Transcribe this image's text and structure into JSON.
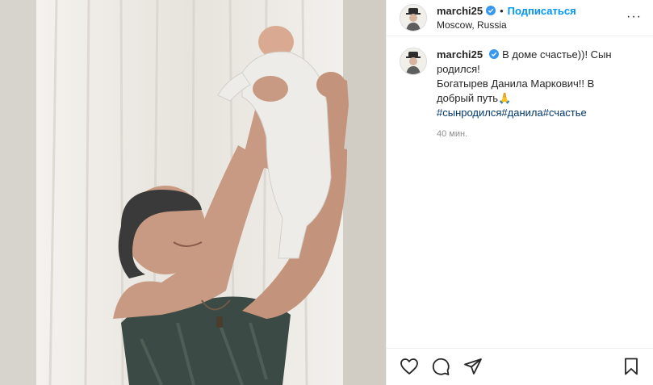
{
  "post": {
    "username": "marchi25",
    "dot": "•",
    "follow_label": "Подписаться",
    "location": "Moscow, Russia",
    "more_label": "···"
  },
  "caption": {
    "username": "marchi25",
    "line1": "В доме счастье))! Сын родился!",
    "line2": "Богатырев Данила Маркович!! В добрый путь🙏",
    "hashtags": [
      "#сынродился",
      "#данила",
      "#счастье"
    ],
    "time": "40 мин."
  },
  "icons": {
    "verified": "verified-badge-icon",
    "like": "heart-icon",
    "comment": "comment-icon",
    "share": "paper-plane-icon",
    "save": "bookmark-icon"
  },
  "colors": {
    "accent": "#0095f6",
    "verified": "#3897f0",
    "hashtag": "#00376b"
  }
}
